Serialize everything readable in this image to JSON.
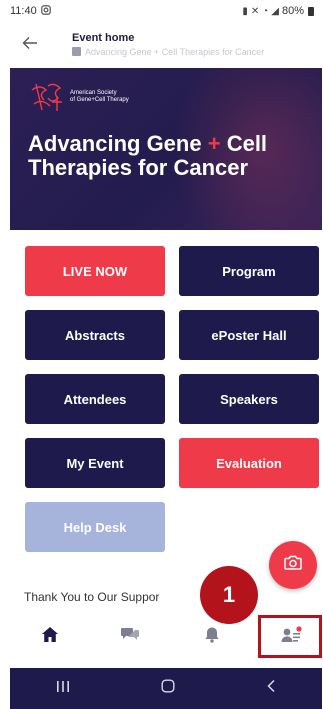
{
  "status": {
    "time": "11:40",
    "battery": "80%"
  },
  "appbar": {
    "title": "Event home",
    "subtitle": "Advancing Gene + Cell Therapies for Cancer"
  },
  "banner": {
    "org_line1": "American Society",
    "org_line2": "of Gene+Cell Therapy",
    "logo_letters": "ASGCT",
    "title_part1": "Advancing Gene ",
    "title_plus": "+",
    "title_part2": " Cell",
    "title_line2": "Therapies for Cancer"
  },
  "buttons": {
    "live_now": "LIVE NOW",
    "program": "Program",
    "abstracts": "Abstracts",
    "eposter_hall": "ePoster Hall",
    "attendees": "Attendees",
    "speakers": "Speakers",
    "my_event": "My Event",
    "evaluation": "Evaluation",
    "help_desk": "Help Desk"
  },
  "sponsors_heading": "Thank You to Our Suppor",
  "step_badge": "1",
  "colors": {
    "navy": "#1e1a4b",
    "red": "#ef3a4a",
    "light": "#a6b4dc",
    "annotation": "#b3141c"
  },
  "icons": {
    "home": "home-icon",
    "chat": "chat-icon",
    "notifications": "bell-icon",
    "profile": "profile-card-icon",
    "camera": "camera-icon"
  }
}
